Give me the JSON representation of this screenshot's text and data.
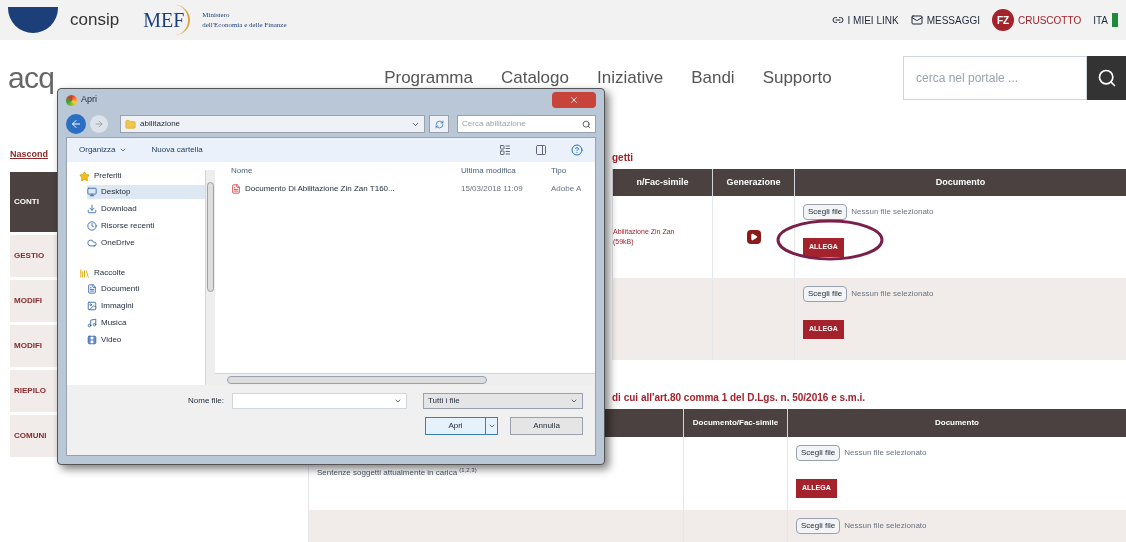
{
  "header": {
    "consip": "consip",
    "mef": "MEF",
    "ministry_line1": "Ministero",
    "ministry_line2": "dell'Economia e delle Finanze",
    "links": [
      "I MIEI LINK",
      "MESSAGGI"
    ],
    "avatar": "FZ",
    "dashboard": "CRUSCOTTO",
    "language": "ITA"
  },
  "nav": {
    "logo": "acq",
    "items": [
      "Programma",
      "Catalogo",
      "Iniziative",
      "Bandi",
      "Supporto"
    ],
    "search": {
      "placeholder": "cerca nel portale ..."
    }
  },
  "sidebar": {
    "toggle": "Nascond",
    "items": [
      {
        "label": "CONTI",
        "selected": true
      },
      {
        "label": "GESTIO",
        "selected": false
      },
      {
        "label": "MODIFI",
        "selected": false
      },
      {
        "label": "MODIFI",
        "selected": false
      },
      {
        "label": "RIEPILO",
        "selected": false
      },
      {
        "label": "COMUNI",
        "selected": false
      }
    ]
  },
  "section1": {
    "title": "getti",
    "columns": [
      "n/Fac-simile",
      "Generazione",
      "Documento"
    ],
    "rows": [
      {
        "template": [
          "Abilitazione Zin Zan",
          "(59kB)"
        ],
        "generate": true,
        "choose": "Scegli file",
        "status": "Nessun file selezionato",
        "attach": "ALLEGA",
        "highlighted": true
      },
      {
        "choose": "Scegli file",
        "status": "Nessun file selezionato",
        "attach": "ALLEGA"
      }
    ]
  },
  "section2": {
    "title": "di cui all'art.80 comma 1 del D.Lgs. n. 50/2016 e s.m.i.",
    "columns": [
      "Documento/Fac-simile",
      "Documento"
    ],
    "rows": [
      {
        "label": "Sentenze soggetti attualmente in carica $^{(1,2,3)}$",
        "choose": "Scegli file",
        "status": "Nessun file selezionato",
        "attach": "ALLEGA"
      },
      {
        "choose": "Scegli file",
        "status": "Nessun file selezionato"
      }
    ]
  },
  "dialog": {
    "title": "Apri",
    "path": "abilitazione",
    "search": {
      "placeholder": "Cerca abilitazione"
    },
    "toolbar": [
      "Organizza",
      "Nuova cartella"
    ],
    "tree": [
      {
        "label": "Preferiti",
        "selected": false,
        "children": [
          {
            "label": "Desktop",
            "selected": true
          },
          {
            "label": "Download",
            "selected": false
          },
          {
            "label": "Risorse recenti",
            "selected": false
          },
          {
            "label": "OneDrive",
            "selected": false
          }
        ]
      },
      {
        "label": "Raccolte",
        "selected": false,
        "children": [
          {
            "label": "Documenti",
            "selected": false
          },
          {
            "label": "Immagini",
            "selected": false
          },
          {
            "label": "Musica",
            "selected": false
          },
          {
            "label": "Video",
            "selected": false
          }
        ]
      }
    ],
    "columns": [
      "Nome",
      "Ultima modifica",
      "Tipo"
    ],
    "files": [
      {
        "name": "Documento Di Abilitazione Zin Zan T160...",
        "modified": "15/03/2018 11:09",
        "type": "Adobe A"
      }
    ],
    "filename_label": "Nome file:",
    "filter": "Tutti i file",
    "buttons": [
      "Apri",
      "Annulla"
    ]
  }
}
